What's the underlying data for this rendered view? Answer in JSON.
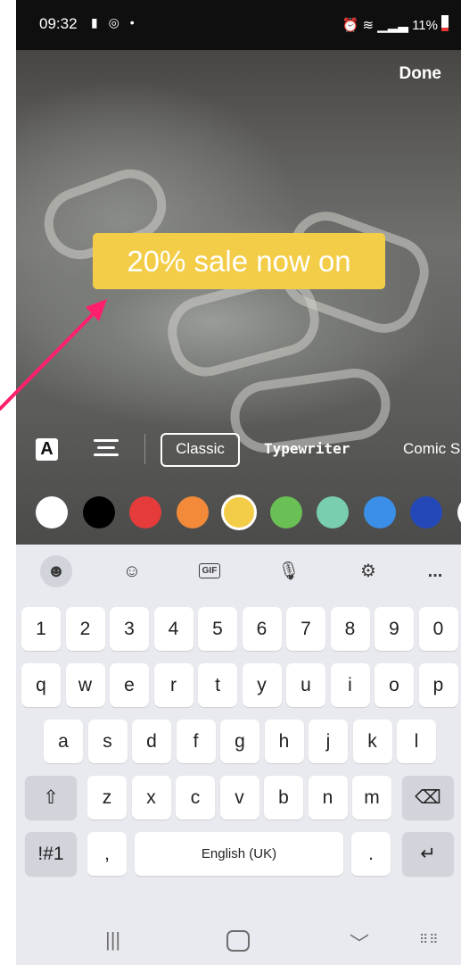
{
  "status_bar": {
    "time": "09:32",
    "battery": "11%"
  },
  "editor": {
    "done_label": "Done",
    "sticker_text": "20% sale now on",
    "style_toggle_label": "A",
    "fonts": [
      "Classic",
      "Typewriter",
      "Comic S"
    ],
    "selected_font": "Classic",
    "colors": [
      "#ffffff",
      "#000000",
      "#e53b3b",
      "#f28a3a",
      "#f3cd47",
      "#6abf55",
      "#79cfad",
      "#3c8fe8",
      "#2448b8",
      "#ffffff"
    ],
    "selected_color": "#f3cd47",
    "annotation_arrow_color": "#ff1f6d"
  },
  "keyboard": {
    "toolbar_icons": [
      "sticker-icon",
      "emoji-icon",
      "gif-icon",
      "microphone-icon",
      "settings-icon",
      "more-icon"
    ],
    "gif_label": "GIF",
    "more_label": "...",
    "row_numbers": [
      "1",
      "2",
      "3",
      "4",
      "5",
      "6",
      "7",
      "8",
      "9",
      "0"
    ],
    "row1": [
      "q",
      "w",
      "e",
      "r",
      "t",
      "y",
      "u",
      "i",
      "o",
      "p"
    ],
    "row2": [
      "a",
      "s",
      "d",
      "f",
      "g",
      "h",
      "j",
      "k",
      "l"
    ],
    "row3": [
      "z",
      "x",
      "c",
      "v",
      "b",
      "n",
      "m"
    ],
    "symbols_label": "!#1",
    "comma": ",",
    "space_label": "English (UK)",
    "period": "."
  },
  "nav_bar": {
    "icons": [
      "recent-apps-icon",
      "home-icon",
      "back-icon",
      "keyboard-toggle-icon"
    ]
  }
}
